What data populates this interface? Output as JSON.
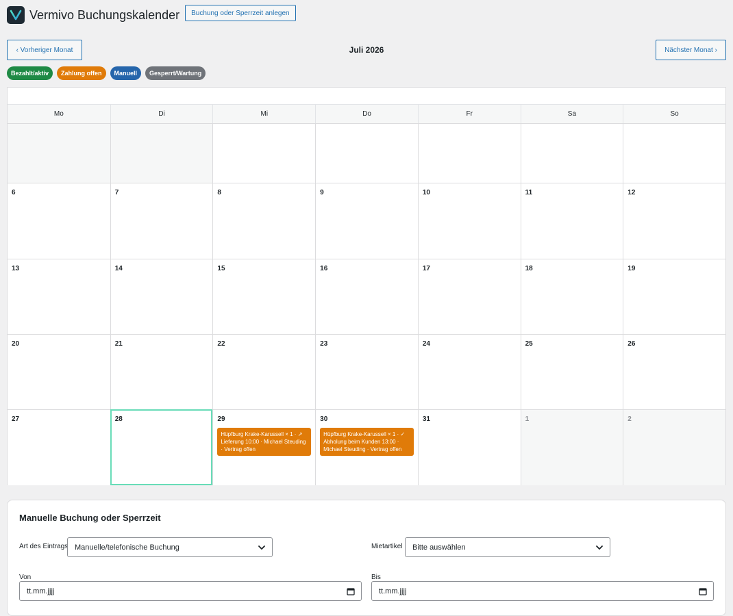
{
  "app": {
    "title": "Vermivo Buchungskalender",
    "add_button": "Buchung oder Sperrzeit anlegen"
  },
  "nav": {
    "prev_label": "‹ Vorheriger Monat",
    "next_label": "Nächster Monat ›",
    "month_title": "Juli 2026"
  },
  "legend": [
    {
      "label": "Bezahlt/aktiv",
      "color": "#1f8a45"
    },
    {
      "label": "Zahlung offen",
      "color": "#e07b09"
    },
    {
      "label": "Manuell",
      "color": "#2565ab"
    },
    {
      "label": "Gesperrt/Wartung",
      "color": "#6f7379"
    }
  ],
  "calendar": {
    "weekdays": [
      "Mo",
      "Di",
      "Mi",
      "Do",
      "Fr",
      "Sa",
      "So"
    ],
    "weeks": [
      [
        {
          "label": "",
          "other": true
        },
        {
          "label": "",
          "other": true
        },
        {
          "label": ""
        },
        {
          "label": ""
        },
        {
          "label": ""
        },
        {
          "label": ""
        },
        {
          "label": ""
        }
      ],
      [
        {
          "label": "6"
        },
        {
          "label": "7"
        },
        {
          "label": "8"
        },
        {
          "label": "9"
        },
        {
          "label": "10"
        },
        {
          "label": "11"
        },
        {
          "label": "12"
        }
      ],
      [
        {
          "label": "13"
        },
        {
          "label": "14"
        },
        {
          "label": "15"
        },
        {
          "label": "16"
        },
        {
          "label": "17"
        },
        {
          "label": "18"
        },
        {
          "label": "19"
        }
      ],
      [
        {
          "label": "20"
        },
        {
          "label": "21"
        },
        {
          "label": "22"
        },
        {
          "label": "23"
        },
        {
          "label": "24"
        },
        {
          "label": "25"
        },
        {
          "label": "26"
        }
      ],
      [
        {
          "label": "27"
        },
        {
          "label": "28",
          "today": true
        },
        {
          "label": "29",
          "events": [
            {
              "text": "Hüpfburg Krake-Karussell × 1 · ↗ Lieferung 10:00 · Michael Steuding · Vertrag offen",
              "color": "#e07b09"
            }
          ]
        },
        {
          "label": "30",
          "events": [
            {
              "text": "Hüpfburg Krake-Karussell × 1 · ✓ Abholung beim Kunden 13:00 · Michael Steuding · Vertrag offen",
              "color": "#e07b09"
            }
          ]
        },
        {
          "label": "31"
        },
        {
          "label": "1",
          "other": true
        },
        {
          "label": "2",
          "other": true
        }
      ]
    ]
  },
  "form": {
    "title": "Manuelle Buchung oder Sperrzeit",
    "type_label": "Art des Eintrags",
    "type_value": "Manuelle/telefonische Buchung",
    "item_label": "Mietartikel",
    "item_value": "Bitte auswählen",
    "from_label": "Von",
    "from_placeholder": "tt.mm.jjjj",
    "to_label": "Bis",
    "to_placeholder": "tt.mm.jjjj"
  },
  "icons": {
    "logo": "vermivo-v-logo",
    "select_arrow": "chevron-down-icon",
    "date_picker": "calendar-icon"
  }
}
